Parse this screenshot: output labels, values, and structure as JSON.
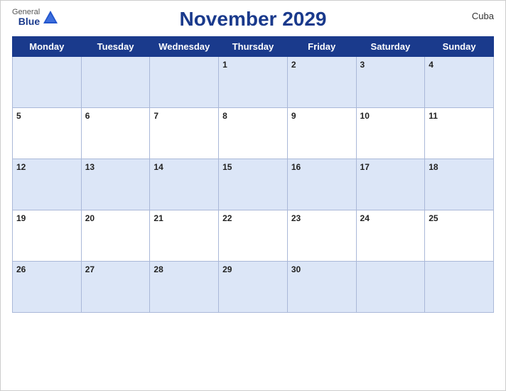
{
  "header": {
    "logo_general": "General",
    "logo_blue": "Blue",
    "title": "November 2029",
    "country": "Cuba"
  },
  "days_of_week": [
    "Monday",
    "Tuesday",
    "Wednesday",
    "Thursday",
    "Friday",
    "Saturday",
    "Sunday"
  ],
  "weeks": [
    [
      null,
      null,
      null,
      1,
      2,
      3,
      4
    ],
    [
      5,
      6,
      7,
      8,
      9,
      10,
      11
    ],
    [
      12,
      13,
      14,
      15,
      16,
      17,
      18
    ],
    [
      19,
      20,
      21,
      22,
      23,
      24,
      25
    ],
    [
      26,
      27,
      28,
      29,
      30,
      null,
      null
    ]
  ]
}
